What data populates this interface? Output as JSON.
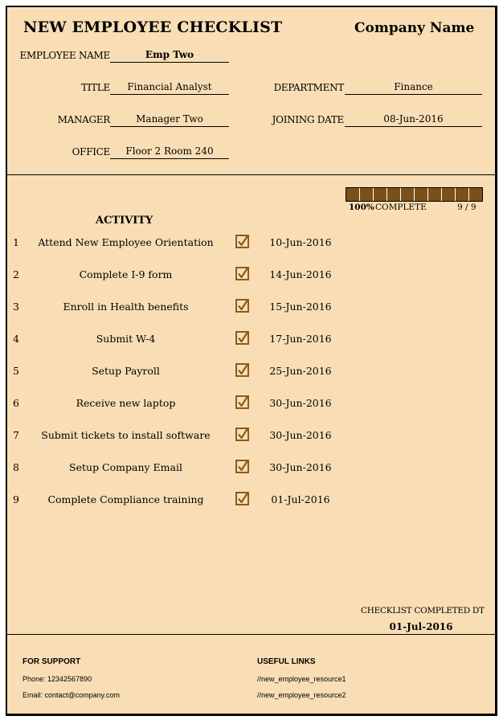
{
  "header": {
    "title": "NEW EMPLOYEE CHECKLIST",
    "company": "Company Name"
  },
  "employee": {
    "name_label": "EMPLOYEE NAME",
    "name": "Emp Two",
    "title_label": "TITLE",
    "title": "Financial Analyst",
    "department_label": "DEPARTMENT",
    "department": "Finance",
    "manager_label": "MANAGER",
    "manager": "Manager Two",
    "joining_label": "JOINING DATE",
    "joining_date": "08-Jun-2016",
    "office_label": "OFFICE",
    "office": "Floor 2 Room 240"
  },
  "progress": {
    "percent": "100%",
    "percent_value": 100,
    "label": "COMPLETE",
    "count": "9 / 9",
    "completed": 9,
    "total": 9,
    "segments": 10,
    "fill_color": "#7B5018"
  },
  "activity": {
    "heading": "ACTIVITY",
    "items": [
      {
        "num": "1",
        "label": "Attend New Employee Orientation",
        "checked": true,
        "date": "10-Jun-2016"
      },
      {
        "num": "2",
        "label": "Complete I-9 form",
        "checked": true,
        "date": "14-Jun-2016"
      },
      {
        "num": "3",
        "label": "Enroll in Health benefits",
        "checked": true,
        "date": "15-Jun-2016"
      },
      {
        "num": "4",
        "label": "Submit W-4",
        "checked": true,
        "date": "17-Jun-2016"
      },
      {
        "num": "5",
        "label": "Setup Payroll",
        "checked": true,
        "date": "25-Jun-2016"
      },
      {
        "num": "6",
        "label": "Receive new laptop",
        "checked": true,
        "date": "30-Jun-2016"
      },
      {
        "num": "7",
        "label": "Submit tickets to install software",
        "checked": true,
        "date": "30-Jun-2016"
      },
      {
        "num": "8",
        "label": "Setup Company Email",
        "checked": true,
        "date": "30-Jun-2016"
      },
      {
        "num": "9",
        "label": "Complete Compliance training",
        "checked": true,
        "date": "01-Jul-2016"
      }
    ]
  },
  "completion": {
    "label": "CHECKLIST COMPLETED DT",
    "date": "01-Jul-2016"
  },
  "footer": {
    "support_heading": "FOR SUPPORT",
    "phone": "Phone: 12342567890",
    "email": "Email: contact@company.com",
    "links_heading": "USEFUL LINKS",
    "link1": "//new_employee_resource1",
    "link2": "//new_employee_resource2"
  },
  "colors": {
    "background": "#F9DEB5",
    "accent_brown": "#7B5018",
    "checkbox_border": "#8B5A1E"
  }
}
